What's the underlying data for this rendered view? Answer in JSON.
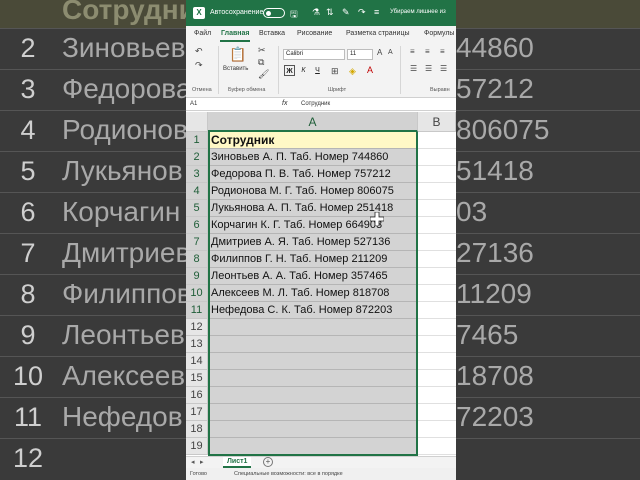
{
  "background": {
    "header_text": "Сотрудник",
    "row_numbers": [
      "2",
      "3",
      "4",
      "5",
      "6",
      "7",
      "8",
      "9",
      "10",
      "11",
      "12"
    ],
    "names_partial": [
      "Зиновьев",
      "Федорова",
      "Родионов",
      "Лукьянов",
      "Корчагин",
      "Дмитриев",
      "Филиппов",
      "Леонтьев",
      "Алексеев",
      "Нефедов"
    ],
    "numbers_partial": [
      "44860",
      "57212",
      "806075",
      "51418",
      "03",
      "27136",
      "11209",
      "7465",
      "18708",
      "72203"
    ]
  },
  "titlebar": {
    "logo": "X",
    "autosave_label": "Автосохранение",
    "title": "Убираем лишнее из"
  },
  "tabs": [
    "Файл",
    "Главная",
    "Вставка",
    "Рисование",
    "Разметка страницы",
    "Формулы"
  ],
  "ribbon": {
    "undo_label": "Отмена",
    "paste_label": "Вставить",
    "clipboard_label": "Буфер обмена",
    "font_label": "Шрифт",
    "align_label": "Выравн",
    "font_name": "Calibri",
    "font_size": "11",
    "bold": "Ж",
    "italic": "К",
    "underline": "Ч"
  },
  "formula_bar": {
    "name_box": "A1",
    "fx": "fx",
    "content": "Сотрудник"
  },
  "grid": {
    "col_a": "A",
    "col_b": "B",
    "rows": [
      {
        "n": "1",
        "a": "Сотрудник"
      },
      {
        "n": "2",
        "a": "Зиновьев А. П. Таб. Номер 744860"
      },
      {
        "n": "3",
        "a": "Федорова П. В. Таб. Номер 757212"
      },
      {
        "n": "4",
        "a": "Родионова М. Г. Таб. Номер 806075"
      },
      {
        "n": "5",
        "a": "Лукьянова А. П. Таб. Номер 251418"
      },
      {
        "n": "6",
        "a": "Корчагин К. Г. Таб. Номер 664903"
      },
      {
        "n": "7",
        "a": "Дмитриев А. Я. Таб. Номер 527136"
      },
      {
        "n": "8",
        "a": "Филиппов Г. Н. Таб. Номер 211209"
      },
      {
        "n": "9",
        "a": "Леонтьев А. А. Таб. Номер 357465"
      },
      {
        "n": "10",
        "a": "Алексеев М. Л. Таб. Номер 818708"
      },
      {
        "n": "11",
        "a": "Нефедова С. К. Таб. Номер 872203"
      },
      {
        "n": "12",
        "a": ""
      },
      {
        "n": "13",
        "a": ""
      },
      {
        "n": "14",
        "a": ""
      },
      {
        "n": "15",
        "a": ""
      },
      {
        "n": "16",
        "a": ""
      },
      {
        "n": "17",
        "a": ""
      },
      {
        "n": "18",
        "a": ""
      },
      {
        "n": "19",
        "a": ""
      }
    ]
  },
  "sheet_tabs": {
    "active": "Лист1",
    "add": "+"
  },
  "status": {
    "ready": "Готово",
    "accessibility": "Специальные возможности: все в порядке"
  },
  "colors": {
    "excel_green": "#217346",
    "header_cell": "#fff8c6",
    "selection": "#d3d3d3"
  }
}
